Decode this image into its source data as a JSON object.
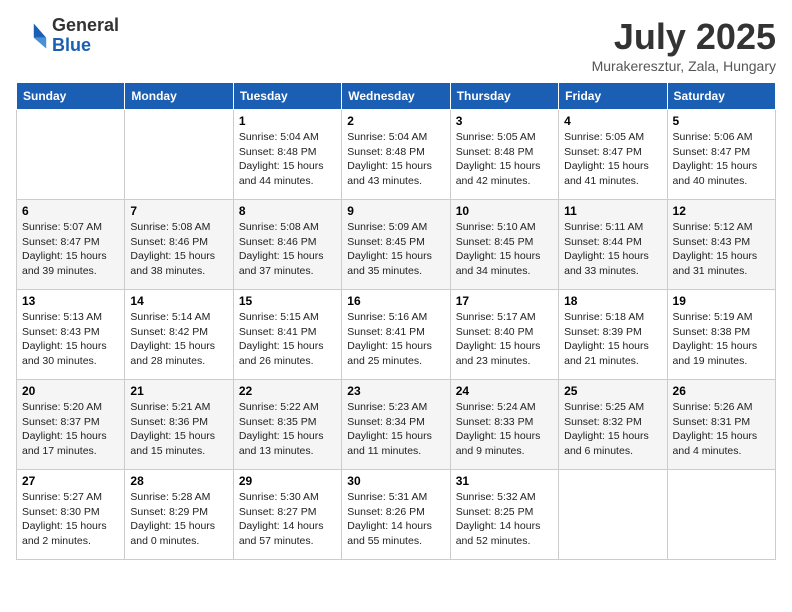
{
  "logo": {
    "general": "General",
    "blue": "Blue"
  },
  "title": "July 2025",
  "location": "Murakeresztur, Zala, Hungary",
  "days_of_week": [
    "Sunday",
    "Monday",
    "Tuesday",
    "Wednesday",
    "Thursday",
    "Friday",
    "Saturday"
  ],
  "weeks": [
    [
      {
        "day": "",
        "sunrise": "",
        "sunset": "",
        "daylight": ""
      },
      {
        "day": "",
        "sunrise": "",
        "sunset": "",
        "daylight": ""
      },
      {
        "day": "1",
        "sunrise": "Sunrise: 5:04 AM",
        "sunset": "Sunset: 8:48 PM",
        "daylight": "Daylight: 15 hours and 44 minutes."
      },
      {
        "day": "2",
        "sunrise": "Sunrise: 5:04 AM",
        "sunset": "Sunset: 8:48 PM",
        "daylight": "Daylight: 15 hours and 43 minutes."
      },
      {
        "day": "3",
        "sunrise": "Sunrise: 5:05 AM",
        "sunset": "Sunset: 8:48 PM",
        "daylight": "Daylight: 15 hours and 42 minutes."
      },
      {
        "day": "4",
        "sunrise": "Sunrise: 5:05 AM",
        "sunset": "Sunset: 8:47 PM",
        "daylight": "Daylight: 15 hours and 41 minutes."
      },
      {
        "day": "5",
        "sunrise": "Sunrise: 5:06 AM",
        "sunset": "Sunset: 8:47 PM",
        "daylight": "Daylight: 15 hours and 40 minutes."
      }
    ],
    [
      {
        "day": "6",
        "sunrise": "Sunrise: 5:07 AM",
        "sunset": "Sunset: 8:47 PM",
        "daylight": "Daylight: 15 hours and 39 minutes."
      },
      {
        "day": "7",
        "sunrise": "Sunrise: 5:08 AM",
        "sunset": "Sunset: 8:46 PM",
        "daylight": "Daylight: 15 hours and 38 minutes."
      },
      {
        "day": "8",
        "sunrise": "Sunrise: 5:08 AM",
        "sunset": "Sunset: 8:46 PM",
        "daylight": "Daylight: 15 hours and 37 minutes."
      },
      {
        "day": "9",
        "sunrise": "Sunrise: 5:09 AM",
        "sunset": "Sunset: 8:45 PM",
        "daylight": "Daylight: 15 hours and 35 minutes."
      },
      {
        "day": "10",
        "sunrise": "Sunrise: 5:10 AM",
        "sunset": "Sunset: 8:45 PM",
        "daylight": "Daylight: 15 hours and 34 minutes."
      },
      {
        "day": "11",
        "sunrise": "Sunrise: 5:11 AM",
        "sunset": "Sunset: 8:44 PM",
        "daylight": "Daylight: 15 hours and 33 minutes."
      },
      {
        "day": "12",
        "sunrise": "Sunrise: 5:12 AM",
        "sunset": "Sunset: 8:43 PM",
        "daylight": "Daylight: 15 hours and 31 minutes."
      }
    ],
    [
      {
        "day": "13",
        "sunrise": "Sunrise: 5:13 AM",
        "sunset": "Sunset: 8:43 PM",
        "daylight": "Daylight: 15 hours and 30 minutes."
      },
      {
        "day": "14",
        "sunrise": "Sunrise: 5:14 AM",
        "sunset": "Sunset: 8:42 PM",
        "daylight": "Daylight: 15 hours and 28 minutes."
      },
      {
        "day": "15",
        "sunrise": "Sunrise: 5:15 AM",
        "sunset": "Sunset: 8:41 PM",
        "daylight": "Daylight: 15 hours and 26 minutes."
      },
      {
        "day": "16",
        "sunrise": "Sunrise: 5:16 AM",
        "sunset": "Sunset: 8:41 PM",
        "daylight": "Daylight: 15 hours and 25 minutes."
      },
      {
        "day": "17",
        "sunrise": "Sunrise: 5:17 AM",
        "sunset": "Sunset: 8:40 PM",
        "daylight": "Daylight: 15 hours and 23 minutes."
      },
      {
        "day": "18",
        "sunrise": "Sunrise: 5:18 AM",
        "sunset": "Sunset: 8:39 PM",
        "daylight": "Daylight: 15 hours and 21 minutes."
      },
      {
        "day": "19",
        "sunrise": "Sunrise: 5:19 AM",
        "sunset": "Sunset: 8:38 PM",
        "daylight": "Daylight: 15 hours and 19 minutes."
      }
    ],
    [
      {
        "day": "20",
        "sunrise": "Sunrise: 5:20 AM",
        "sunset": "Sunset: 8:37 PM",
        "daylight": "Daylight: 15 hours and 17 minutes."
      },
      {
        "day": "21",
        "sunrise": "Sunrise: 5:21 AM",
        "sunset": "Sunset: 8:36 PM",
        "daylight": "Daylight: 15 hours and 15 minutes."
      },
      {
        "day": "22",
        "sunrise": "Sunrise: 5:22 AM",
        "sunset": "Sunset: 8:35 PM",
        "daylight": "Daylight: 15 hours and 13 minutes."
      },
      {
        "day": "23",
        "sunrise": "Sunrise: 5:23 AM",
        "sunset": "Sunset: 8:34 PM",
        "daylight": "Daylight: 15 hours and 11 minutes."
      },
      {
        "day": "24",
        "sunrise": "Sunrise: 5:24 AM",
        "sunset": "Sunset: 8:33 PM",
        "daylight": "Daylight: 15 hours and 9 minutes."
      },
      {
        "day": "25",
        "sunrise": "Sunrise: 5:25 AM",
        "sunset": "Sunset: 8:32 PM",
        "daylight": "Daylight: 15 hours and 6 minutes."
      },
      {
        "day": "26",
        "sunrise": "Sunrise: 5:26 AM",
        "sunset": "Sunset: 8:31 PM",
        "daylight": "Daylight: 15 hours and 4 minutes."
      }
    ],
    [
      {
        "day": "27",
        "sunrise": "Sunrise: 5:27 AM",
        "sunset": "Sunset: 8:30 PM",
        "daylight": "Daylight: 15 hours and 2 minutes."
      },
      {
        "day": "28",
        "sunrise": "Sunrise: 5:28 AM",
        "sunset": "Sunset: 8:29 PM",
        "daylight": "Daylight: 15 hours and 0 minutes."
      },
      {
        "day": "29",
        "sunrise": "Sunrise: 5:30 AM",
        "sunset": "Sunset: 8:27 PM",
        "daylight": "Daylight: 14 hours and 57 minutes."
      },
      {
        "day": "30",
        "sunrise": "Sunrise: 5:31 AM",
        "sunset": "Sunset: 8:26 PM",
        "daylight": "Daylight: 14 hours and 55 minutes."
      },
      {
        "day": "31",
        "sunrise": "Sunrise: 5:32 AM",
        "sunset": "Sunset: 8:25 PM",
        "daylight": "Daylight: 14 hours and 52 minutes."
      },
      {
        "day": "",
        "sunrise": "",
        "sunset": "",
        "daylight": ""
      },
      {
        "day": "",
        "sunrise": "",
        "sunset": "",
        "daylight": ""
      }
    ]
  ]
}
